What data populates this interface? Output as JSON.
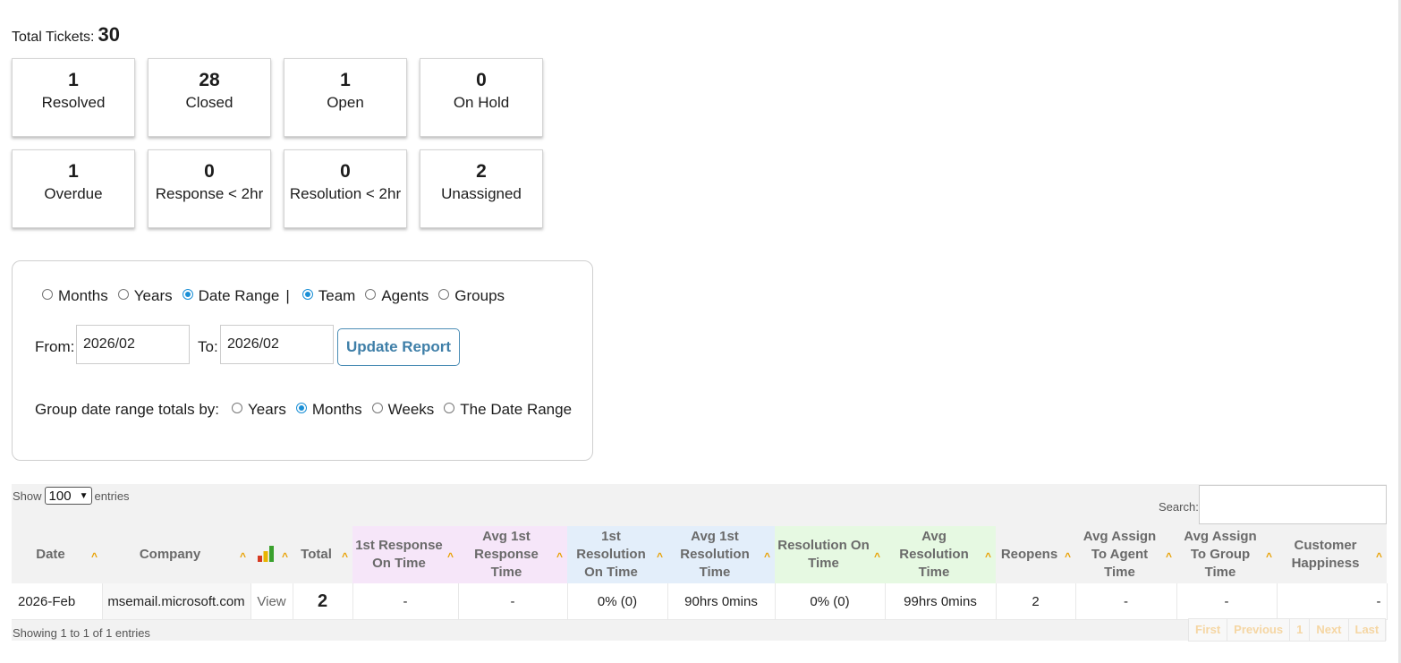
{
  "summary": {
    "total_label": "Total Tickets:",
    "total_value": "30",
    "cards": [
      {
        "value": "1",
        "label": "Resolved"
      },
      {
        "value": "28",
        "label": "Closed"
      },
      {
        "value": "1",
        "label": "Open"
      },
      {
        "value": "0",
        "label": "On Hold"
      },
      {
        "value": "1",
        "label": "Overdue"
      },
      {
        "value": "0",
        "label": "Response < 2hr"
      },
      {
        "value": "0",
        "label": "Resolution < 2hr"
      },
      {
        "value": "2",
        "label": "Unassigned"
      }
    ]
  },
  "filters": {
    "period_options": [
      "Months",
      "Years",
      "Date Range"
    ],
    "period_selected": "Date Range",
    "separator": "|",
    "scope_options": [
      "Team",
      "Agents",
      "Groups"
    ],
    "scope_selected": "Team",
    "from_label": "From:",
    "from_value": "2026/02",
    "to_label": "To:",
    "to_value": "2026/02",
    "update_button": "Update Report",
    "group_label": "Group date range totals by:",
    "group_options": [
      "Years",
      "Months",
      "Weeks",
      "The Date Range"
    ],
    "group_selected": "Months"
  },
  "table": {
    "show_label": "Show",
    "entries_value": "100",
    "entries_label": "entries",
    "search_label": "Search:",
    "search_value": "",
    "columns": [
      "Date",
      "Company",
      "",
      "Total",
      "1st Response On Time",
      "Avg 1st Response Time",
      "1st Resolution On Time",
      "Avg 1st Resolution Time",
      "Resolution On Time",
      "Avg Resolution Time",
      "Reopens",
      "Avg Assign To Agent Time",
      "Avg Assign To Group Time",
      "Customer Happiness"
    ],
    "rows": [
      [
        "2026-Feb",
        "msemail.microsoft.com",
        "View",
        "2",
        "-",
        "-",
        "0% (0)",
        "90hrs 0mins",
        "0% (0)",
        "99hrs 0mins",
        "2",
        "-",
        "-",
        "-"
      ]
    ],
    "info": "Showing 1 to 1 of 1 entries",
    "pagination": [
      "First",
      "Previous",
      "1",
      "Next",
      "Last"
    ]
  },
  "colors": {
    "accent": "#1a8fd6",
    "sort_arrow": "#e8a000",
    "header_pink": "#f6e6f9",
    "header_blue": "#e3eefa",
    "header_green": "#e6f9e2"
  }
}
